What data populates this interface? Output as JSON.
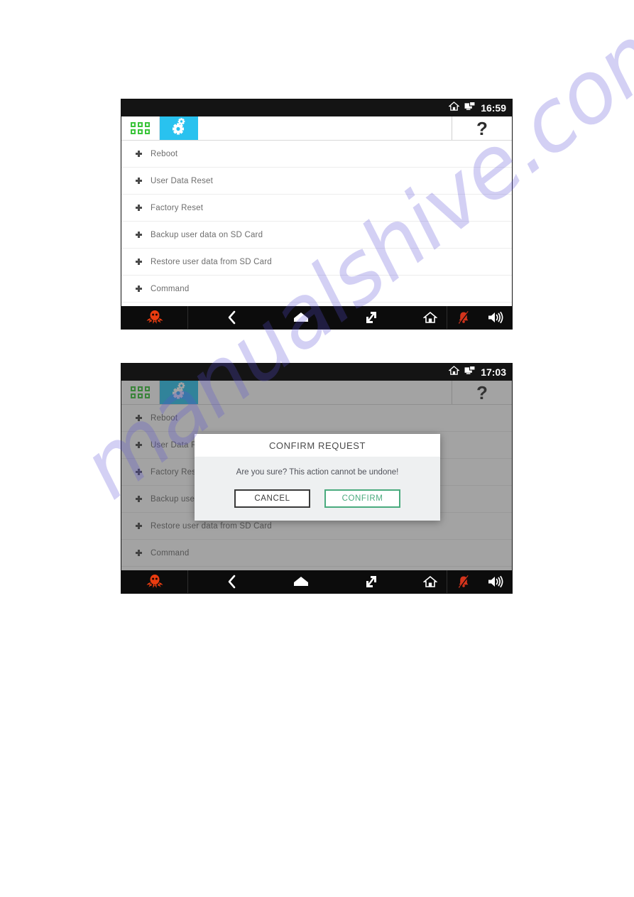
{
  "page": {
    "watermark": "manualshive.com",
    "background": "#ffffff"
  },
  "colors": {
    "statusbar_bg": "#141414",
    "navbar_bg": "#0c0c0c",
    "tab_active": "#29c2ef",
    "tab_active_dimmed": "#1b8ba9",
    "grid_green": "#3ac43a",
    "logo_red": "#ea3c10",
    "confirm_green": "#4aab7e",
    "cancel_dark": "#3a3a3a",
    "dialog_body": "#eef0f1",
    "menu_text": "#6d6d6d"
  },
  "screenshot_1": {
    "statusbar": {
      "icons": [
        "home-icon",
        "screen-share-icon"
      ],
      "time": "16:59"
    },
    "header": {
      "tab_apps_icon": "apps-grid-icon",
      "tab_settings_icon": "gears-icon",
      "help_label": "?"
    },
    "menu": {
      "items": [
        {
          "label": "Reboot"
        },
        {
          "label": "User Data Reset"
        },
        {
          "label": "Factory Reset"
        },
        {
          "label": "Backup user data on SD Card"
        },
        {
          "label": "Restore user data from SD Card"
        },
        {
          "label": "Command"
        }
      ]
    },
    "navbar": {
      "logo": "octopus-logo",
      "buttons": [
        "back-icon",
        "home-pentagon-icon",
        "recent-apps-icon",
        "home-house-icon",
        "alarm-muted-icon",
        "volume-icon"
      ]
    }
  },
  "screenshot_2": {
    "statusbar": {
      "icons": [
        "home-icon",
        "screen-share-icon"
      ],
      "time": "17:03"
    },
    "header": {
      "tab_apps_icon": "apps-grid-icon",
      "tab_settings_icon": "gears-icon",
      "help_label": "?"
    },
    "menu": {
      "items": [
        {
          "label": "Reboot"
        },
        {
          "label": "User Data Reset"
        },
        {
          "label": "Factory Reset"
        },
        {
          "label": "Backup user data on SD Card"
        },
        {
          "label": "Restore user data from SD Card"
        },
        {
          "label": "Command"
        }
      ]
    },
    "dialog": {
      "title": "CONFIRM REQUEST",
      "message": "Are you sure? This action cannot be undone!",
      "cancel_label": "CANCEL",
      "confirm_label": "CONFIRM"
    },
    "navbar": {
      "logo": "octopus-logo",
      "buttons": [
        "back-icon",
        "home-pentagon-icon",
        "recent-apps-icon",
        "home-house-icon",
        "alarm-muted-icon",
        "volume-icon"
      ]
    }
  }
}
